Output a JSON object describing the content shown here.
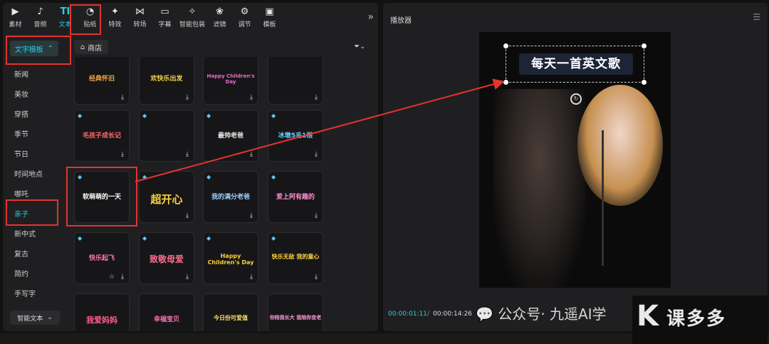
{
  "toolbar": {
    "items": [
      {
        "label": "素材",
        "icon": "media-icon",
        "glyph": "▶"
      },
      {
        "label": "音频",
        "icon": "audio-icon",
        "glyph": "♪"
      },
      {
        "label": "文本",
        "icon": "text-icon",
        "glyph": "TI"
      },
      {
        "label": "贴纸",
        "icon": "sticker-icon",
        "glyph": "◔"
      },
      {
        "label": "特效",
        "icon": "effects-icon",
        "glyph": "✦"
      },
      {
        "label": "转场",
        "icon": "transition-icon",
        "glyph": "⋈"
      },
      {
        "label": "字幕",
        "icon": "subtitle-icon",
        "glyph": "▭"
      },
      {
        "label": "智能包装",
        "icon": "smart-pack-icon",
        "glyph": "✧"
      },
      {
        "label": "滤镜",
        "icon": "filter-icon",
        "glyph": "❀"
      },
      {
        "label": "调节",
        "icon": "adjust-icon",
        "glyph": "⚙"
      },
      {
        "label": "模板",
        "icon": "template-icon",
        "glyph": "▣"
      }
    ],
    "more": "»"
  },
  "sidebar": {
    "head": "文字模板",
    "items": [
      "新闻",
      "美妆",
      "穿搭",
      "季节",
      "节日",
      "时间地点",
      "哪吒",
      "亲子",
      "新中式",
      "复古",
      "简约",
      "手写字"
    ],
    "smart": "智能文本"
  },
  "store": {
    "label": "商店"
  },
  "cards": [
    {
      "label": "经典怀旧",
      "color": "#f0a040"
    },
    {
      "label": "欢快乐出发",
      "color": "#f3d24a"
    },
    {
      "label": "Happy Children's Day",
      "color": "#e96bc7"
    },
    {
      "label": "",
      "color": "#fff"
    },
    {
      "label": "毛孩子成长记",
      "color": "#ff6a6a"
    },
    {
      "label": "",
      "color": "#fff"
    },
    {
      "label": "最帅老爸",
      "color": "#eaeaea"
    },
    {
      "label": "冰墩5毛1根",
      "color": "#66d0ff"
    },
    {
      "label": "软萌萌的一天",
      "color": "#ffffff"
    },
    {
      "label": "超开心",
      "color": "#ffcf3a"
    },
    {
      "label": "我的满分老爸",
      "color": "#9bd0ff"
    },
    {
      "label": "爱上阿有趣的",
      "color": "#ff8ad0"
    },
    {
      "label": "快乐起飞",
      "color": "#ff7aa8"
    },
    {
      "label": "致敬母爱",
      "color": "#ff6b8f"
    },
    {
      "label": "Happy Children's Day",
      "color": "#ffcf3a"
    },
    {
      "label": "快乐无敌 我的童心",
      "color": "#ffd23a"
    },
    {
      "label": "我爱妈妈",
      "color": "#ff5c8a"
    },
    {
      "label": "幸福宝贝",
      "color": "#ff6fb0"
    },
    {
      "label": "今日份可爱值",
      "color": "#ffe26a"
    },
    {
      "label": "你陪我长大 我陪你变老",
      "color": "#ff9ad4"
    }
  ],
  "player": {
    "title": "播放器",
    "overlay_text": "每天一首英文歌",
    "time_current": "00:00:01:11",
    "time_sep": "/",
    "time_total": "00:00:14:26"
  },
  "watermark": {
    "text": "公众号· 九遥AI学",
    "logo_letter": "K",
    "logo_text": "课多多"
  }
}
